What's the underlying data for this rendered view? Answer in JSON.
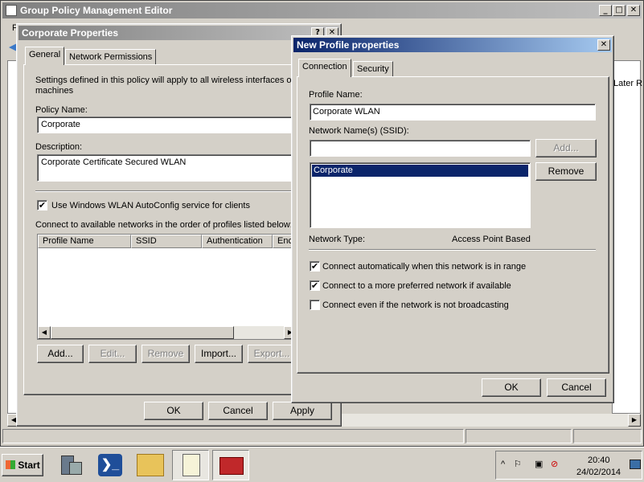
{
  "main_window": {
    "title": "Group Policy Management Editor",
    "menu_stub": "F",
    "right_text": "Later R"
  },
  "corp_dialog": {
    "title": "Corporate Properties",
    "help_glyph": "?",
    "close_glyph": "✕",
    "tabs": [
      "General",
      "Network Permissions"
    ],
    "intro": "Settings defined in this policy will apply to all wireless interfaces of machines",
    "intro_line1": "Settings defined in this policy will apply to all wireless interfaces of",
    "intro_line2": "machines",
    "policy_name_label": "Policy Name:",
    "policy_name_value": "Corporate",
    "description_label": "Description:",
    "description_value": "Corporate Certificate Secured WLAN",
    "autoconfig_label": "Use Windows WLAN AutoConfig service for clients",
    "autoconfig_checked": true,
    "connect_order_label": "Connect to available networks in the order of profiles listed below:",
    "columns": [
      "Profile Name",
      "SSID",
      "Authentication",
      "Enc"
    ],
    "buttons": {
      "add": "Add...",
      "edit": "Edit...",
      "remove": "Remove",
      "import": "Import...",
      "export": "Export..."
    },
    "footer": {
      "ok": "OK",
      "cancel": "Cancel",
      "apply": "Apply"
    }
  },
  "profile_dialog": {
    "title": "New Profile properties",
    "close_glyph": "✕",
    "tabs": [
      "Connection",
      "Security"
    ],
    "profile_name_label": "Profile Name:",
    "profile_name_value": "Corporate WLAN",
    "ssid_label": "Network Name(s) (SSID):",
    "ssid_input_value": "",
    "add_button": "Add...",
    "remove_button": "Remove",
    "ssid_list": [
      "Corporate"
    ],
    "network_type_label": "Network Type:",
    "network_type_value": "Access Point Based",
    "options": [
      {
        "label": "Connect automatically when this network is in range",
        "checked": true
      },
      {
        "label": "Connect to a more preferred network if available",
        "checked": true
      },
      {
        "label": "Connect even if the network is not broadcasting",
        "checked": false
      }
    ],
    "ok": "OK",
    "cancel": "Cancel"
  },
  "taskbar": {
    "start_label": "Start",
    "time": "20:40",
    "date": "24/02/2014",
    "icons": [
      "server-manager-icon",
      "powershell-icon",
      "explorer-icon",
      "policy-editor-icon",
      "toolbox-icon"
    ]
  },
  "colors": {
    "active_title": "#0a246a",
    "inactive_title": "#808080",
    "selection": "#0a246a",
    "face": "#d4d0c8"
  }
}
